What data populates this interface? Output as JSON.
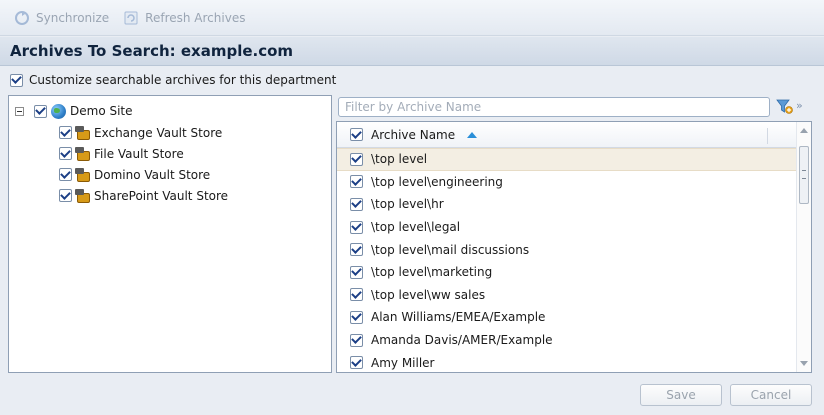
{
  "toolbar": {
    "synchronize_label": "Synchronize",
    "refresh_label": "Refresh Archives",
    "synchronize_icon": "sync-icon",
    "refresh_icon": "refresh-icon"
  },
  "title": "Archives To Search: example.com",
  "customize_label": "Customize searchable archives for this department",
  "tree": {
    "root_label": "Demo Site",
    "children": [
      {
        "label": "Exchange Vault Store"
      },
      {
        "label": "File Vault Store"
      },
      {
        "label": "Domino Vault Store"
      },
      {
        "label": "SharePoint Vault Store"
      }
    ]
  },
  "filter": {
    "placeholder": "Filter by Archive Name",
    "value": ""
  },
  "grid": {
    "column_header": "Archive Name",
    "sort": "ascending",
    "rows": [
      {
        "name": "\\top level"
      },
      {
        "name": "\\top level\\engineering"
      },
      {
        "name": "\\top level\\hr"
      },
      {
        "name": "\\top level\\legal"
      },
      {
        "name": "\\top level\\mail discussions"
      },
      {
        "name": "\\top level\\marketing"
      },
      {
        "name": "\\top level\\ww sales"
      },
      {
        "name": "Alan Williams/EMEA/Example"
      },
      {
        "name": "Amanda Davis/AMER/Example"
      },
      {
        "name": "Amy Miller"
      }
    ]
  },
  "footer": {
    "save_label": "Save",
    "cancel_label": "Cancel"
  },
  "colors": {
    "accent": "#2b8fd8",
    "selected_row": "#f3eee3",
    "background": "#e9edf3"
  }
}
